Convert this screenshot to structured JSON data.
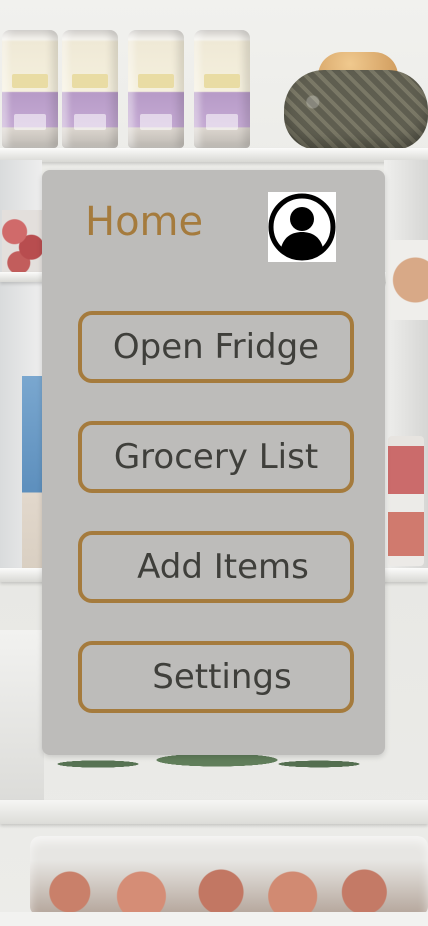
{
  "header": {
    "title": "Home",
    "profile_icon": "user-profile-icon"
  },
  "menu": {
    "items": [
      {
        "label": "Open Fridge"
      },
      {
        "label": "Grocery List"
      },
      {
        "label": "Add Items"
      },
      {
        "label": "Settings"
      }
    ]
  },
  "colors": {
    "accent": "#a57b3d",
    "panel_background": "#bdbcba",
    "button_text": "#3f3f3b",
    "profile_icon": "#000000"
  }
}
